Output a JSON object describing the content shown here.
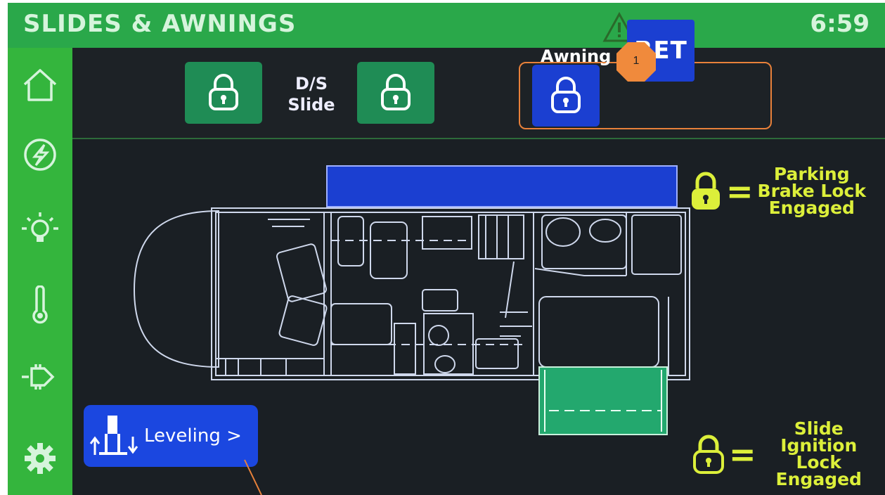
{
  "header": {
    "title": "SLIDES & AWNINGS",
    "clock": "6:59",
    "warning_icon": "warning-triangle-icon"
  },
  "sidebar": {
    "items": [
      {
        "name": "home",
        "icon": "home-icon"
      },
      {
        "name": "power",
        "icon": "power-lightning-icon"
      },
      {
        "name": "lights",
        "icon": "light-bulb-icon"
      },
      {
        "name": "climate",
        "icon": "thermometer-icon"
      },
      {
        "name": "tanks",
        "icon": "plug-icon"
      },
      {
        "name": "settings",
        "icon": "gear-icon"
      }
    ]
  },
  "controls": {
    "ds_slide_label_line1": "D/S",
    "ds_slide_label_line2": "Slide",
    "awning_label": "Awning",
    "ret_label": "RET",
    "callout_number": "1"
  },
  "legend": {
    "parking": {
      "line1": "Parking",
      "line2": "Brake Lock",
      "line3": "Engaged"
    },
    "slide": {
      "line1": "Slide",
      "line2": "Ignition",
      "line3": "Lock",
      "line4": "Engaged"
    }
  },
  "leveling": {
    "label": "Leveling >"
  },
  "colors": {
    "header": "#2aa84a",
    "sidebar": "#34b53d",
    "lock_green": "#1f8c55",
    "awning_blue": "#1b3fd1",
    "legend_yellow": "#dcef3a",
    "callout_orange": "#e8813a"
  }
}
